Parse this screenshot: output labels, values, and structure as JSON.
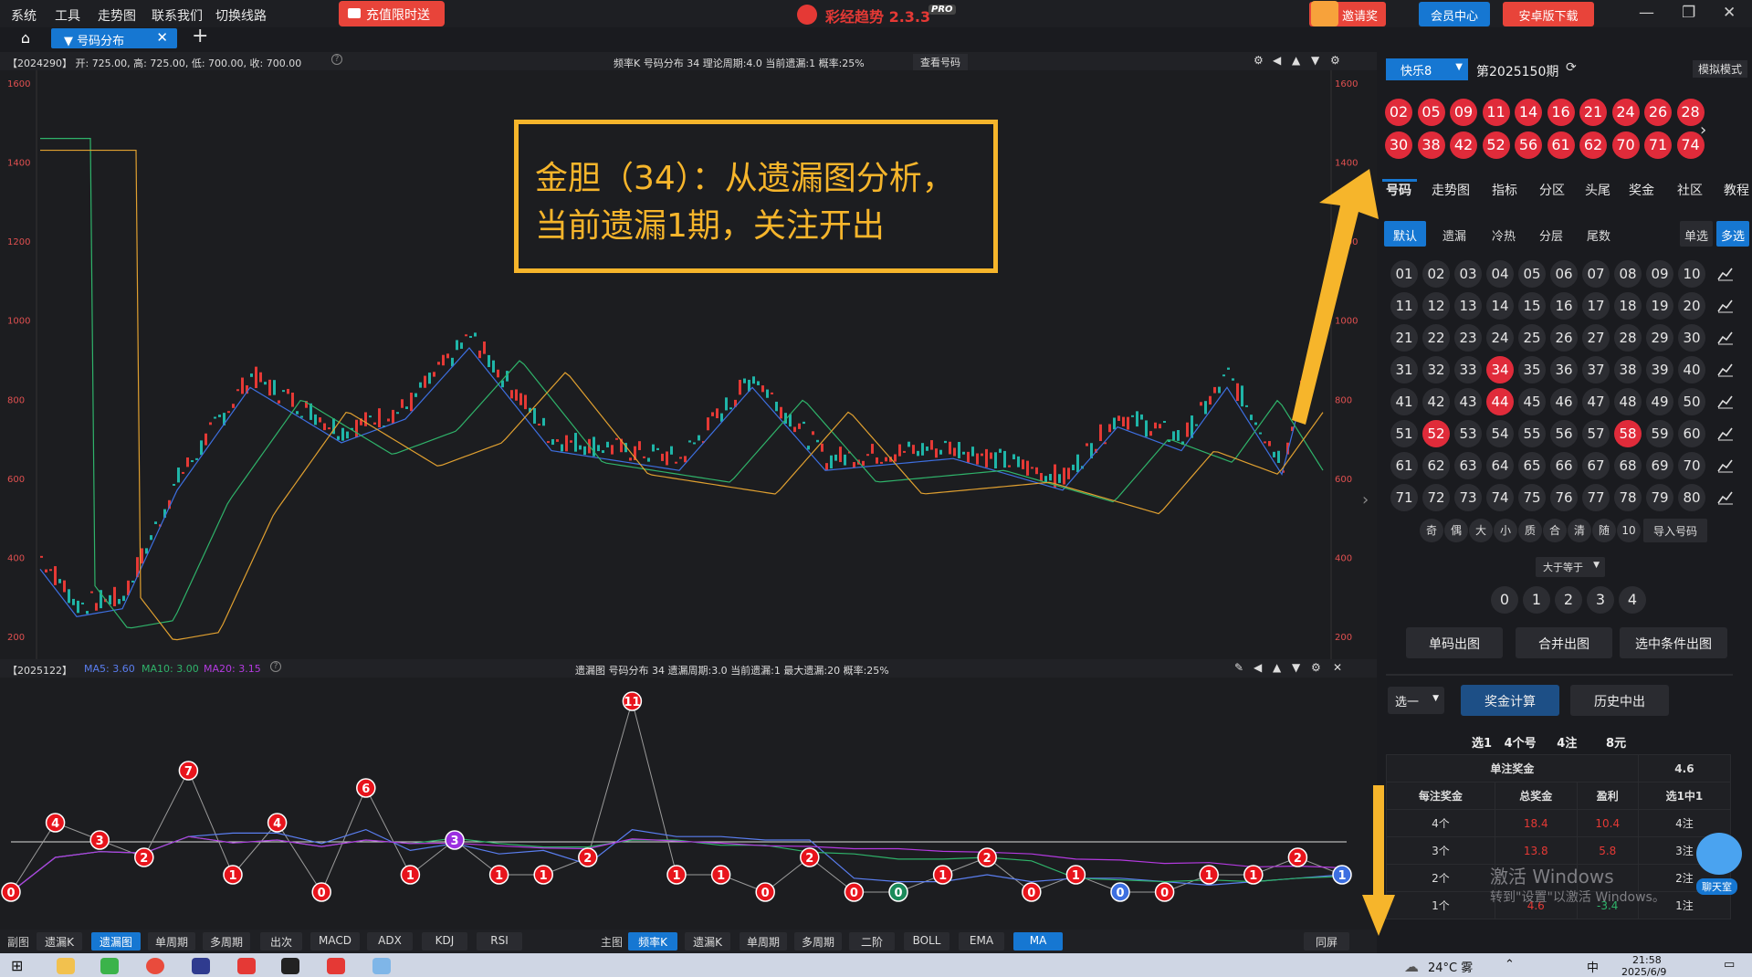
{
  "topbar": {
    "menu": [
      "系统",
      "工具",
      "走势图",
      "联系我们",
      "切换线路"
    ],
    "recharge_label": "充值限时送",
    "app_title": "彩经趋势 2.3.3",
    "app_edition": "PRO",
    "invite_label": "邀请奖励",
    "member_label": "会员中心",
    "android_label": "安卓版下载"
  },
  "tabs": {
    "active_label": "号码分布"
  },
  "main_chart": {
    "header_left": "【2024290】 开: 725.00, 高: 725.00, 低: 700.00, 收: 700.00",
    "header_center": "频率K  号码分布 34  理论周期:4.0  当前遗漏:1  概率:25%",
    "view_button": "查看号码",
    "y_ticks": [
      "1600",
      "1400",
      "1200",
      "1000",
      "800",
      "600",
      "400",
      "200"
    ],
    "y_range": [
      200,
      1600
    ]
  },
  "annotation": {
    "line1": "金胆（34）：从遗漏图分析，",
    "line2": "当前遗漏1期，关注开出"
  },
  "sub_chart": {
    "header_left": "【2025122】",
    "ma5": "MA5: 3.60",
    "ma10": "MA10: 3.00",
    "ma20": "MA20: 3.15",
    "header_center": "遗漏图  号码分布 34  遗漏周期:3.0  当前遗漏:1  最大遗漏:20  概率:25%"
  },
  "chart_data": {
    "type": "line",
    "title": "遗漏图 号码分布 34",
    "series": [
      {
        "name": "遗漏",
        "values": [
          0,
          4,
          3,
          2,
          7,
          1,
          4,
          0,
          6,
          1,
          3,
          1,
          1,
          2,
          11,
          1,
          1,
          0,
          2,
          0,
          0,
          1,
          2,
          0,
          1,
          0,
          0,
          1,
          1,
          2,
          1
        ]
      }
    ]
  },
  "bottom_toolbar": {
    "sub_label": "副图",
    "sub_buttons": [
      "遗漏K",
      "遗漏图",
      "单周期",
      "多周期",
      "出次",
      "MACD",
      "ADX",
      "KDJ",
      "RSI"
    ],
    "main_label": "主图",
    "main_buttons": [
      "频率K",
      "遗漏K",
      "单周期",
      "多周期",
      "二阶",
      "BOLL",
      "EMA",
      "MA"
    ],
    "sync_label": "同屏"
  },
  "right_panel": {
    "lottery_select": "快乐8",
    "issue": "第2025150期",
    "sim_mode": "模拟模式",
    "draw_numbers": [
      "02",
      "05",
      "09",
      "11",
      "14",
      "16",
      "21",
      "24",
      "26",
      "28",
      "30",
      "38",
      "42",
      "52",
      "56",
      "61",
      "62",
      "70",
      "71",
      "74"
    ],
    "nav_tabs": [
      "号码",
      "走势图",
      "指标",
      "分区",
      "头尾",
      "奖金",
      "社区",
      "教程"
    ],
    "filter_tabs": [
      "默认",
      "遗漏",
      "冷热",
      "分层",
      "尾数"
    ],
    "mode_single": "单选",
    "mode_multi": "多选",
    "selected_numbers": [
      "34",
      "44",
      "52",
      "58"
    ],
    "quick_filters": [
      "奇",
      "偶",
      "大",
      "小",
      "质",
      "合",
      "清",
      "随",
      "10",
      "导入号码"
    ],
    "compare_select": "大于等于",
    "hit_counts": [
      "0",
      "1",
      "2",
      "3",
      "4"
    ],
    "chart_buttons": [
      "单码出图",
      "合并出图",
      "选中条件出图"
    ],
    "play_select": "选一",
    "calc_button": "奖金计算",
    "history_button": "历史中出",
    "summary": "选1   4个号     4注       8元",
    "single_prize_label": "单注奖金",
    "single_prize_value": "4.6",
    "table_headers": [
      "每注奖金",
      "总奖金",
      "盈利",
      "选1中1"
    ],
    "table_rows": [
      [
        "4个",
        "18.4",
        "10.4",
        "4注"
      ],
      [
        "3个",
        "13.8",
        "5.8",
        "3注"
      ],
      [
        "2个",
        "",
        "",
        "2注"
      ],
      [
        "1个",
        "4.6",
        "-3.4",
        "1注"
      ]
    ],
    "chat_label": "聊天室"
  },
  "watermark": {
    "line1": "激活 Windows",
    "line2": "转到\"设置\"以激活 Windows。"
  },
  "taskbar": {
    "weather": "24°C 雾",
    "time": "21:58",
    "date": "2025/6/9",
    "ime": "中"
  }
}
